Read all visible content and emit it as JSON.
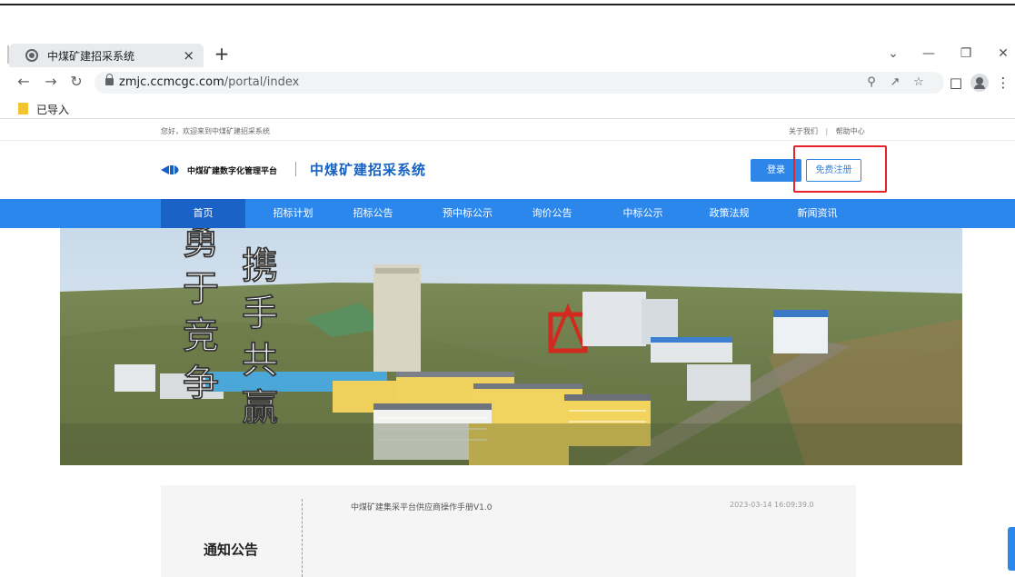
{
  "browser": {
    "tab_title": "中煤矿建招采系统",
    "tab_close": "×",
    "new_tab": "+",
    "url_host": "zmjc.ccmcgc.com",
    "url_path": "/portal/index",
    "bookmark_folder": "已导入",
    "window_controls": [
      "chevron-down-icon",
      "minimize-icon",
      "restore-icon",
      "close-icon"
    ]
  },
  "topbar": {
    "welcome": "您好，欢迎来到中煤矿建招采系统",
    "about": "关于我们",
    "separator": "|",
    "help": "帮助中心"
  },
  "header": {
    "logo_text": "中煤矿建数字化管理平台",
    "site_title": "中煤矿建招采系统",
    "login": "登录",
    "register": "免费注册"
  },
  "nav": {
    "items": [
      "首页",
      "招标计划",
      "招标公告",
      "预中标公示",
      "询价公告",
      "中标公示",
      "政策法规",
      "新闻资讯"
    ],
    "active": "首页"
  },
  "banner": {
    "slogan": "勇于竞争 携手共赢"
  },
  "notice": {
    "heading": "通知公告",
    "items": [
      {
        "title": "中煤矿建集采平台供应商操作手册V1.0",
        "date": "2023-03-14 16:09:39.0"
      }
    ]
  },
  "colors": {
    "brand_blue": "#2c87ec",
    "nav_active": "#1a62c6",
    "title_blue": "#1661c4",
    "highlight_red": "#e5232a"
  }
}
